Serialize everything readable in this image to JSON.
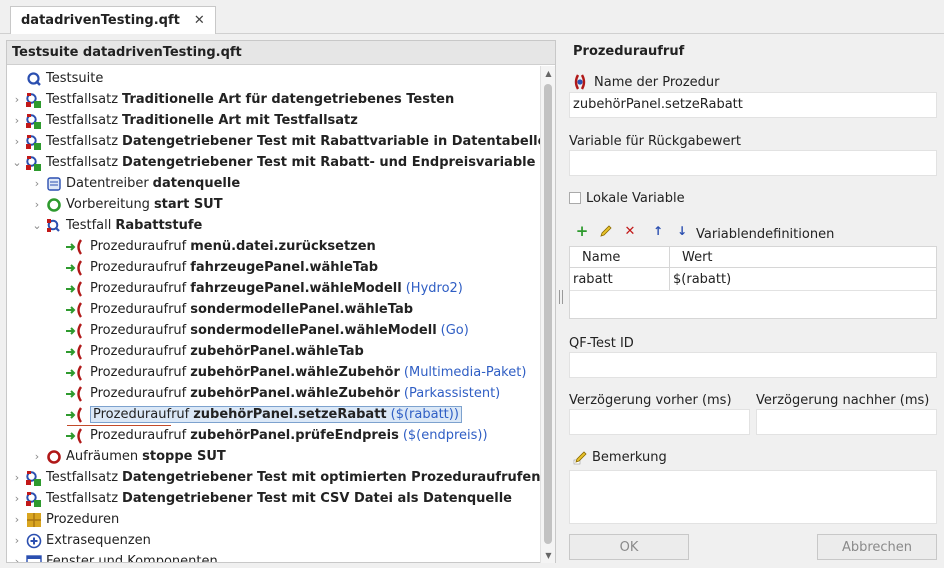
{
  "tab": {
    "title": "datadrivenTesting.qft",
    "close": "✕"
  },
  "left": {
    "header": "Testsuite datadrivenTesting.qft"
  },
  "tree": [
    {
      "chev": "",
      "icon": "testsuite",
      "name": "testsuite",
      "prefix": "Testsuite",
      "bold": "",
      "param": ""
    },
    {
      "chev": "›",
      "icon": "testset",
      "name": "testset",
      "prefix": "Testfallsatz",
      "bold": "Traditionelle Art für datengetriebenes Testen",
      "param": ""
    },
    {
      "chev": "›",
      "icon": "testset",
      "name": "testset",
      "prefix": "Testfallsatz",
      "bold": "Traditionelle Art mit Testfallsatz",
      "param": ""
    },
    {
      "chev": "›",
      "icon": "testset",
      "name": "testset",
      "prefix": "Testfallsatz",
      "bold": "Datengetriebener Test mit Rabattvariable in Datentabelle",
      "param": ""
    },
    {
      "chev": "⌄",
      "icon": "testset",
      "name": "testset",
      "prefix": "Testfallsatz",
      "bold": "Datengetriebener Test mit Rabatt- und Endpreisvariable",
      "param": ""
    },
    {
      "chev": "›",
      "icon": "datadriver",
      "name": "datadriver",
      "prefix": "Datentreiber",
      "bold": "datenquelle",
      "param": ""
    },
    {
      "chev": "›",
      "icon": "setup",
      "name": "setup",
      "prefix": "Vorbereitung",
      "bold": "start SUT",
      "param": ""
    },
    {
      "chev": "⌄",
      "icon": "testcase",
      "name": "testcase",
      "prefix": "Testfall",
      "bold": "Rabattstufe",
      "param": ""
    },
    {
      "chev": "",
      "icon": "proccall",
      "name": "procedure-call",
      "prefix": "Prozeduraufruf",
      "bold": "menü.datei.zurücksetzen",
      "param": ""
    },
    {
      "chev": "",
      "icon": "proccall",
      "name": "procedure-call",
      "prefix": "Prozeduraufruf",
      "bold": "fahrzeugePanel.wähleTab",
      "param": ""
    },
    {
      "chev": "",
      "icon": "proccall",
      "name": "procedure-call",
      "prefix": "Prozeduraufruf",
      "bold": "fahrzeugePanel.wähleModell",
      "param": "(Hydro2)"
    },
    {
      "chev": "",
      "icon": "proccall",
      "name": "procedure-call",
      "prefix": "Prozeduraufruf",
      "bold": "sondermodellePanel.wähleTab",
      "param": ""
    },
    {
      "chev": "",
      "icon": "proccall",
      "name": "procedure-call",
      "prefix": "Prozeduraufruf",
      "bold": "sondermodellePanel.wähleModell",
      "param": "(Go)"
    },
    {
      "chev": "",
      "icon": "proccall",
      "name": "procedure-call",
      "prefix": "Prozeduraufruf",
      "bold": "zubehörPanel.wähleTab",
      "param": ""
    },
    {
      "chev": "",
      "icon": "proccall",
      "name": "procedure-call",
      "prefix": "Prozeduraufruf",
      "bold": "zubehörPanel.wähleZubehör",
      "param": "(Multimedia-Paket)"
    },
    {
      "chev": "",
      "icon": "proccall",
      "name": "procedure-call",
      "prefix": "Prozeduraufruf",
      "bold": "zubehörPanel.wähleZubehör",
      "param": "(Parkassistent)"
    },
    {
      "chev": "",
      "icon": "proccall",
      "name": "procedure-call-selected",
      "prefix": "Prozeduraufruf",
      "bold": "zubehörPanel.setzeRabatt",
      "param": "($(rabatt))",
      "selected": true
    },
    {
      "chev": "",
      "icon": "proccall",
      "name": "procedure-call",
      "prefix": "Prozeduraufruf",
      "bold": "zubehörPanel.prüfeEndpreis",
      "param": "($(endpreis))"
    },
    {
      "chev": "›",
      "icon": "cleanup",
      "name": "cleanup",
      "prefix": "Aufräumen",
      "bold": "stoppe SUT",
      "param": ""
    },
    {
      "chev": "›",
      "icon": "testset",
      "name": "testset",
      "prefix": "Testfallsatz",
      "bold": "Datengetriebener Test mit optimierten Prozeduraufrufen",
      "param": ""
    },
    {
      "chev": "›",
      "icon": "testset",
      "name": "testset",
      "prefix": "Testfallsatz",
      "bold": "Datengetriebener Test mit CSV Datei als Datenquelle",
      "param": ""
    },
    {
      "chev": "›",
      "icon": "procedures",
      "name": "procedures",
      "prefix": "Prozeduren",
      "bold": "",
      "param": ""
    },
    {
      "chev": "›",
      "icon": "extras",
      "name": "extra-sequences",
      "prefix": "Extrasequenzen",
      "bold": "",
      "param": ""
    },
    {
      "chev": "›",
      "icon": "windows",
      "name": "windows-components",
      "prefix": "Fenster und Komponenten",
      "bold": "",
      "param": ""
    }
  ],
  "right": {
    "title": "Prozeduraufruf",
    "proc_name_label": "Name der Prozedur",
    "proc_name_value": "zubehörPanel.setzeRabatt",
    "return_var_label": "Variable für Rückgabewert",
    "return_var_value": "",
    "local_var_label": "Lokale Variable",
    "vardefs_label": "Variablendefinitionen",
    "table": {
      "headers": [
        "Name",
        "Wert"
      ],
      "rows": [
        {
          "name": "rabatt",
          "value": "$(rabatt)"
        }
      ]
    },
    "qf_id_label": "QF-Test ID",
    "delay_before_label": "Verzögerung vorher (ms)",
    "delay_after_label": "Verzögerung nachher (ms)",
    "comment_label": "Bemerkung",
    "ok_label": "OK",
    "cancel_label": "Abbrechen"
  }
}
